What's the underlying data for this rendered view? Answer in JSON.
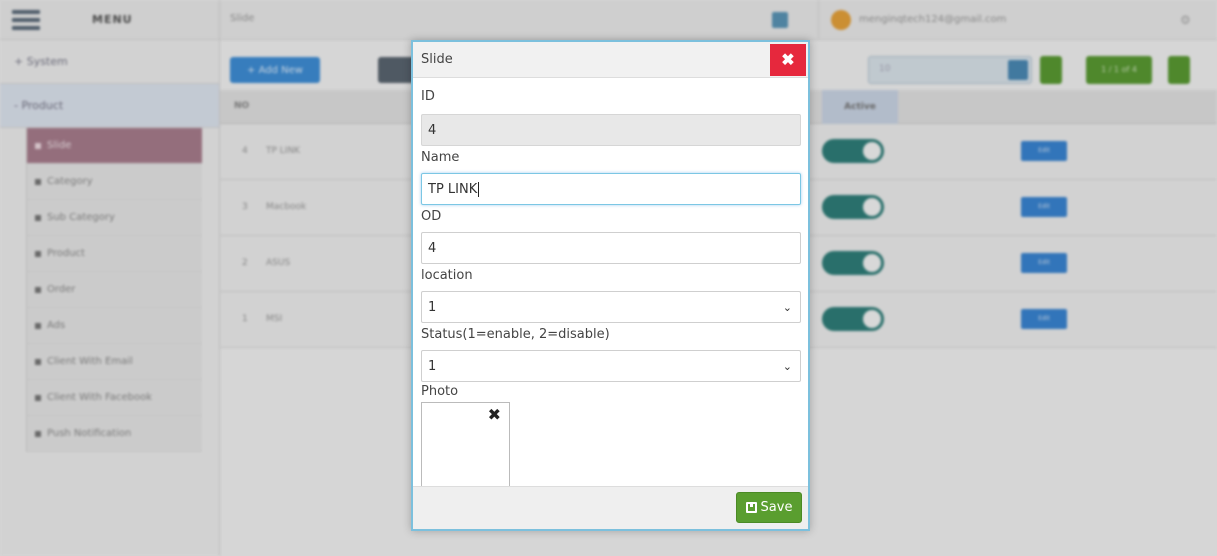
{
  "app": {
    "menu_title": "MENU",
    "top_search": "Slide",
    "user_email": "menginqtech124@gmail.com"
  },
  "sidebar": {
    "groups": [
      {
        "label": "+ System"
      },
      {
        "label": "- Product"
      }
    ],
    "items": [
      {
        "label": "Slide",
        "active": true
      },
      {
        "label": "Category"
      },
      {
        "label": "Sub Category"
      },
      {
        "label": "Product"
      },
      {
        "label": "Order"
      },
      {
        "label": "Ads"
      },
      {
        "label": "Client With Email"
      },
      {
        "label": "Client With Facebook"
      },
      {
        "label": "Push Notification"
      }
    ]
  },
  "toolbar": {
    "add_label": "+ Add New",
    "page_size": "10",
    "pager": "1 / 1 of 4"
  },
  "table": {
    "headers": {
      "no": "NO",
      "action": "Active"
    },
    "rows": [
      {
        "no": "4",
        "name": "TP LINK",
        "edit": "Edit"
      },
      {
        "no": "3",
        "name": "Macbook",
        "edit": "Edit"
      },
      {
        "no": "2",
        "name": "ASUS",
        "edit": "Edit"
      },
      {
        "no": "1",
        "name": "MSI",
        "edit": "Edit"
      }
    ]
  },
  "modal": {
    "title": "Slide",
    "close_glyph": "✖",
    "fields": {
      "id_label": "ID",
      "id_value": "4",
      "name_label": "Name",
      "name_value": "TP LINK",
      "od_label": "OD",
      "od_value": "4",
      "location_label": "location",
      "location_value": "1",
      "status_label": "Status(1=enable, 2=disable)",
      "status_value": "1",
      "photo_label": "Photo",
      "photo_remove_glyph": "✖"
    },
    "save_label": "Save",
    "chevron_glyph": "⌄"
  },
  "colors": {
    "close": "#e6283d",
    "save": "#5a9e2f",
    "modal_border": "#7cc0dd"
  }
}
